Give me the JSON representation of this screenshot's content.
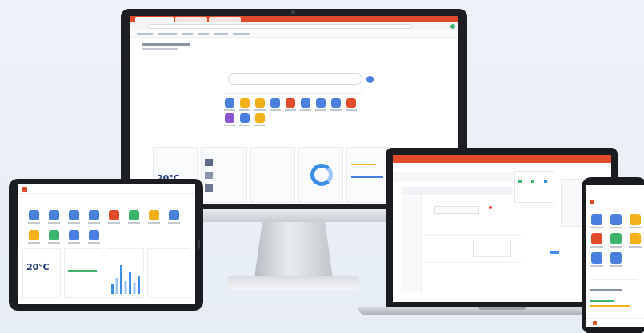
{
  "desktop": {
    "weather": "20℃",
    "accent_color": "#e14a2a",
    "primary_color": "#1f3d7a",
    "app_icon_colors": [
      "#4a7fe0",
      "#f2b11b",
      "#f2b11b",
      "#4a7fe0",
      "#e14a2a",
      "#4a7fe0",
      "#4a7fe0",
      "#4a7fe0",
      "#e14a2a",
      "#8a53d4",
      "#4a7fe0",
      "#f2b11b"
    ]
  },
  "tablet": {
    "weather": "20℃",
    "app_icon_colors": [
      "#4a7fe0",
      "#4a7fe0",
      "#4a7fe0",
      "#4a7fe0",
      "#e14a2a",
      "#3cb46e",
      "#f2b11b",
      "#4a7fe0",
      "#f2b11b",
      "#3cb46e",
      "#4a7fe0",
      "#4a7fe0"
    ],
    "bar_heights": [
      0.3,
      0.5,
      0.9,
      0.4,
      0.7,
      0.35,
      0.55
    ]
  },
  "phone": {
    "app_icon_colors": [
      "#4a7fe0",
      "#4a7fe0",
      "#f2b11b",
      "#e14a2a",
      "#3cb46e",
      "#f2b11b",
      "#4a7fe0",
      "#4a7fe0"
    ]
  }
}
